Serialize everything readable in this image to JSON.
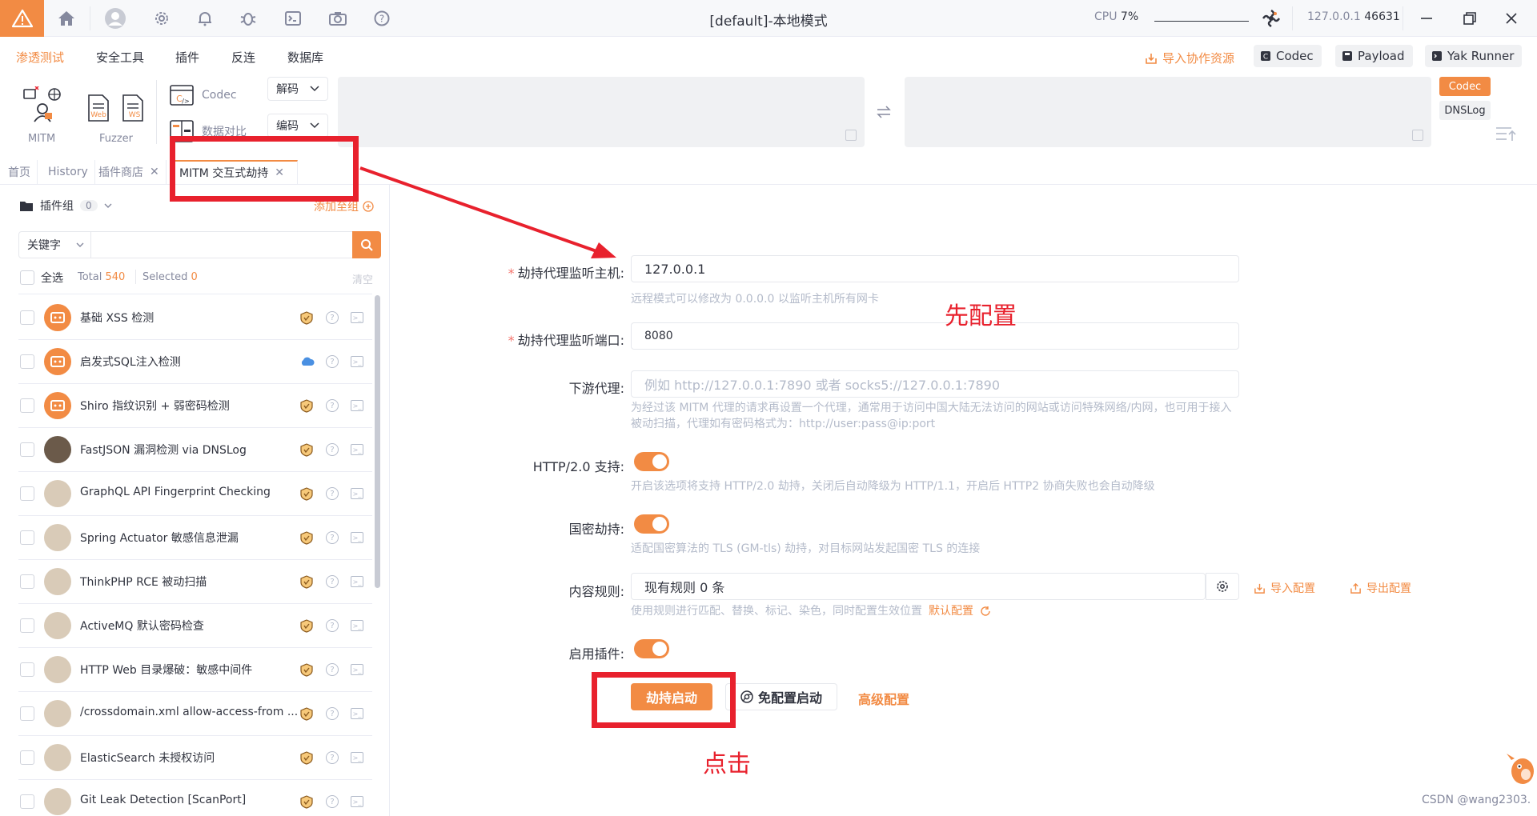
{
  "titlebar": {
    "title": "[default]-本地模式",
    "cpu_label": "CPU",
    "cpu_value": "7%",
    "ip": "127.0.0.1",
    "port": "46631"
  },
  "menu": {
    "items": [
      "渗透测试",
      "安全工具",
      "插件",
      "反连",
      "数据库"
    ],
    "import_link": "导入协作资源",
    "buttons": [
      "Codec",
      "Payload",
      "Yak Runner"
    ]
  },
  "tools": {
    "mitm": "MITM",
    "fuzzer": "Fuzzer",
    "codec": "Codec",
    "data_compare": "数据对比",
    "decode": "解码",
    "encode": "编码",
    "side_codec": "Codec",
    "side_dnslog": "DNSLog"
  },
  "tabs": [
    {
      "label": "首页"
    },
    {
      "label": "History"
    },
    {
      "label": "插件商店"
    },
    {
      "label": "MITM 交互式劫持"
    }
  ],
  "left": {
    "group_label": "插件组",
    "group_count": "0",
    "add_group": "添加至组",
    "keyword": "关键字",
    "select_all": "全选",
    "total_label": "Total",
    "total_value": "540",
    "selected_label": "Selected",
    "selected_value": "0",
    "clear": "清空",
    "plugins": [
      {
        "name": "基础 XSS 检测",
        "badge": "shield-icon"
      },
      {
        "name": "启发式SQL注入检测",
        "badge": "cloud-icon"
      },
      {
        "name": "Shiro 指纹识别 + 弱密码检测",
        "badge": "shield-icon"
      },
      {
        "name": "FastJSON 漏洞检测 via DNSLog",
        "badge": "shield-icon"
      },
      {
        "name": "GraphQL API Fingerprint Checking",
        "badge": "shield-icon"
      },
      {
        "name": "Spring Actuator 敏感信息泄漏",
        "badge": "shield-icon"
      },
      {
        "name": "ThinkPHP RCE 被动扫描",
        "badge": "shield-icon"
      },
      {
        "name": "ActiveMQ 默认密码检查",
        "badge": "shield-icon"
      },
      {
        "name": "HTTP Web 目录爆破：敏感中间件",
        "badge": "shield-icon"
      },
      {
        "name": "/crossdomain.xml allow-access-from ...",
        "badge": "shield-icon"
      },
      {
        "name": "ElasticSearch 未授权访问",
        "badge": "shield-icon"
      },
      {
        "name": "Git Leak Detection [ScanPort]",
        "badge": "shield-icon"
      }
    ]
  },
  "form": {
    "host_label": "劫持代理监听主机:",
    "host_value": "127.0.0.1",
    "host_help": "远程模式可以修改为 0.0.0.0 以监听主机所有网卡",
    "port_label": "劫持代理监听端口:",
    "port_value": "8080",
    "downstream_label": "下游代理:",
    "downstream_placeholder": "例如 http://127.0.0.1:7890 或者 socks5://127.0.0.1:7890",
    "downstream_help": "为经过该 MITM 代理的请求再设置一个代理，通常用于访问中国大陆无法访问的网站或访问特殊网络/内网，也可用于接入被动扫描，代理如有密码格式为：http://user:pass@ip:port",
    "http2_label": "HTTP/2.0 支持:",
    "http2_help": "开启该选项将支持 HTTP/2.0 劫持，关闭后自动降级为 HTTP/1.1，开启后 HTTP2 协商失败也会自动降级",
    "gm_label": "国密劫持:",
    "gm_help": "适配国密算法的 TLS (GM-tls) 劫持，对目标网站发起国密 TLS 的连接",
    "rules_label": "内容规则:",
    "rules_value": "现有规则 0 条",
    "import_config": "导入配置",
    "export_config": "导出配置",
    "rules_help": "使用规则进行匹配、替换、标记、染色，同时配置生效位置",
    "default_config": "默认配置",
    "plugins_label": "启用插件:",
    "start_button": "劫持启动",
    "free_start_button": "免配置启动",
    "advanced": "高级配置"
  },
  "annotations": {
    "configure_first": "先配置",
    "click": "点击"
  },
  "watermark": "CSDN @wang2303.",
  "colors": {
    "accent": "#f28b44",
    "annotation_red": "#e8212d"
  }
}
